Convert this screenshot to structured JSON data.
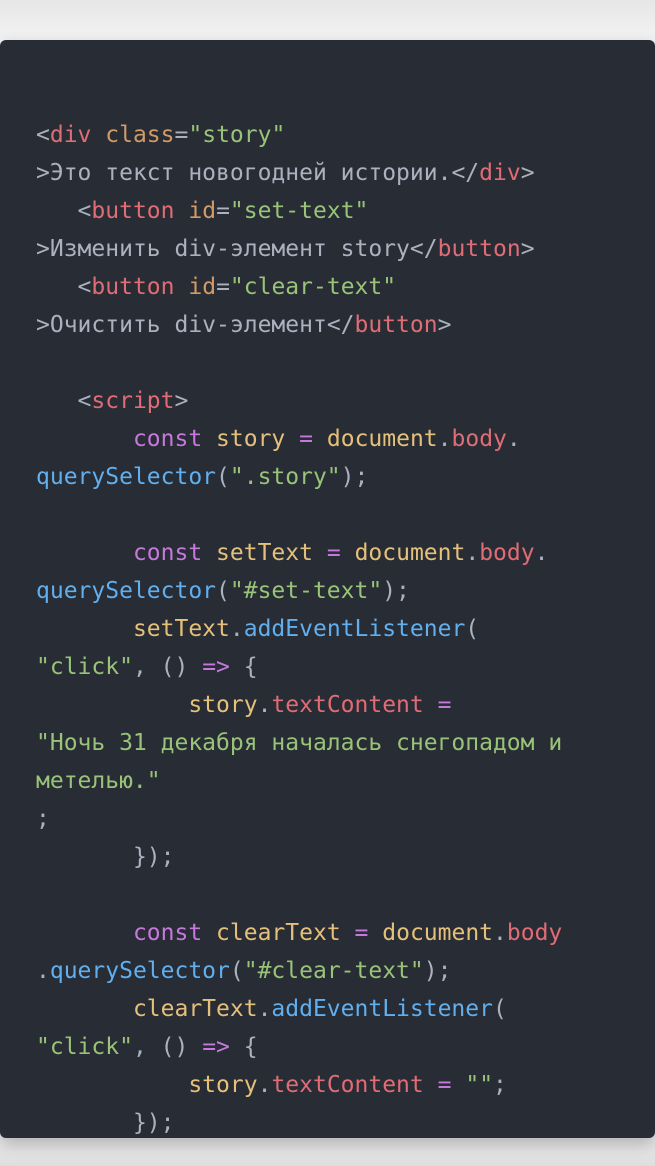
{
  "colors": {
    "background": "#282c34",
    "default": "#abb2bf",
    "tag": "#e06c75",
    "attribute": "#d19a66",
    "string": "#98c379",
    "keyword": "#c678dd",
    "variable": "#e5c07b",
    "property": "#e06c75",
    "function": "#61afef",
    "operator": "#c678dd"
  },
  "code_lines": [
    [
      [
        "punct",
        "<"
      ],
      [
        "tag",
        "div"
      ],
      [
        "text",
        " "
      ],
      [
        "attr",
        "class"
      ],
      [
        "punct",
        "="
      ],
      [
        "str",
        "\"story\""
      ]
    ],
    [
      [
        "punct",
        ">"
      ],
      [
        "text",
        "Это текст новогодней истории."
      ],
      [
        "punct",
        "</"
      ],
      [
        "tag",
        "div"
      ],
      [
        "punct",
        ">"
      ]
    ],
    [
      [
        "text",
        "   "
      ],
      [
        "punct",
        "<"
      ],
      [
        "tag",
        "button"
      ],
      [
        "text",
        " "
      ],
      [
        "attr",
        "id"
      ],
      [
        "punct",
        "="
      ],
      [
        "str",
        "\"set-text\""
      ]
    ],
    [
      [
        "punct",
        ">"
      ],
      [
        "text",
        "Изменить div-элемент story"
      ],
      [
        "punct",
        "</"
      ],
      [
        "tag",
        "button"
      ],
      [
        "punct",
        ">"
      ]
    ],
    [
      [
        "text",
        "   "
      ],
      [
        "punct",
        "<"
      ],
      [
        "tag",
        "button"
      ],
      [
        "text",
        " "
      ],
      [
        "attr",
        "id"
      ],
      [
        "punct",
        "="
      ],
      [
        "str",
        "\"clear-text\""
      ]
    ],
    [
      [
        "punct",
        ">"
      ],
      [
        "text",
        "Очистить div-элемент"
      ],
      [
        "punct",
        "</"
      ],
      [
        "tag",
        "button"
      ],
      [
        "punct",
        ">"
      ]
    ],
    [],
    [
      [
        "text",
        "   "
      ],
      [
        "punct",
        "<"
      ],
      [
        "tag",
        "script"
      ],
      [
        "punct",
        ">"
      ]
    ],
    [
      [
        "text",
        "       "
      ],
      [
        "kw",
        "const"
      ],
      [
        "text",
        " "
      ],
      [
        "var",
        "story"
      ],
      [
        "text",
        " "
      ],
      [
        "op",
        "="
      ],
      [
        "text",
        " "
      ],
      [
        "var",
        "document"
      ],
      [
        "punct",
        "."
      ],
      [
        "prop",
        "body"
      ],
      [
        "punct",
        "."
      ]
    ],
    [
      [
        "func",
        "querySelector"
      ],
      [
        "punct",
        "("
      ],
      [
        "str",
        "\".story\""
      ],
      [
        "punct",
        ");"
      ]
    ],
    [],
    [
      [
        "text",
        "       "
      ],
      [
        "kw",
        "const"
      ],
      [
        "text",
        " "
      ],
      [
        "var",
        "setText"
      ],
      [
        "text",
        " "
      ],
      [
        "op",
        "="
      ],
      [
        "text",
        " "
      ],
      [
        "var",
        "document"
      ],
      [
        "punct",
        "."
      ],
      [
        "prop",
        "body"
      ],
      [
        "punct",
        "."
      ]
    ],
    [
      [
        "func",
        "querySelector"
      ],
      [
        "punct",
        "("
      ],
      [
        "str",
        "\"#set-text\""
      ],
      [
        "punct",
        ");"
      ]
    ],
    [
      [
        "text",
        "       "
      ],
      [
        "var",
        "setText"
      ],
      [
        "punct",
        "."
      ],
      [
        "func",
        "addEventListener"
      ],
      [
        "punct",
        "("
      ]
    ],
    [
      [
        "str",
        "\"click\""
      ],
      [
        "punct",
        ", () "
      ],
      [
        "op",
        "=>"
      ],
      [
        "punct",
        " {"
      ]
    ],
    [
      [
        "text",
        "           "
      ],
      [
        "var",
        "story"
      ],
      [
        "punct",
        "."
      ],
      [
        "prop",
        "textContent"
      ],
      [
        "text",
        " "
      ],
      [
        "op",
        "="
      ]
    ],
    [
      [
        "str",
        "\"Ночь 31 декабря началась снегопадом и"
      ]
    ],
    [
      [
        "str",
        "метелью.\""
      ]
    ],
    [
      [
        "punct",
        ";"
      ]
    ],
    [
      [
        "text",
        "       "
      ],
      [
        "punct",
        "});"
      ]
    ],
    [],
    [
      [
        "text",
        "       "
      ],
      [
        "kw",
        "const"
      ],
      [
        "text",
        " "
      ],
      [
        "var",
        "clearText"
      ],
      [
        "text",
        " "
      ],
      [
        "op",
        "="
      ],
      [
        "text",
        " "
      ],
      [
        "var",
        "document"
      ],
      [
        "punct",
        "."
      ],
      [
        "prop",
        "body"
      ]
    ],
    [
      [
        "punct",
        "."
      ],
      [
        "func",
        "querySelector"
      ],
      [
        "punct",
        "("
      ],
      [
        "str",
        "\"#clear-text\""
      ],
      [
        "punct",
        ");"
      ]
    ],
    [
      [
        "text",
        "       "
      ],
      [
        "var",
        "clearText"
      ],
      [
        "punct",
        "."
      ],
      [
        "func",
        "addEventListener"
      ],
      [
        "punct",
        "("
      ]
    ],
    [
      [
        "str",
        "\"click\""
      ],
      [
        "punct",
        ", () "
      ],
      [
        "op",
        "=>"
      ],
      [
        "punct",
        " {"
      ]
    ],
    [
      [
        "text",
        "           "
      ],
      [
        "var",
        "story"
      ],
      [
        "punct",
        "."
      ],
      [
        "prop",
        "textContent"
      ],
      [
        "text",
        " "
      ],
      [
        "op",
        "="
      ],
      [
        "text",
        " "
      ],
      [
        "str",
        "\"\""
      ],
      [
        "punct",
        ";"
      ]
    ],
    [
      [
        "text",
        "       "
      ],
      [
        "punct",
        "});"
      ]
    ]
  ]
}
